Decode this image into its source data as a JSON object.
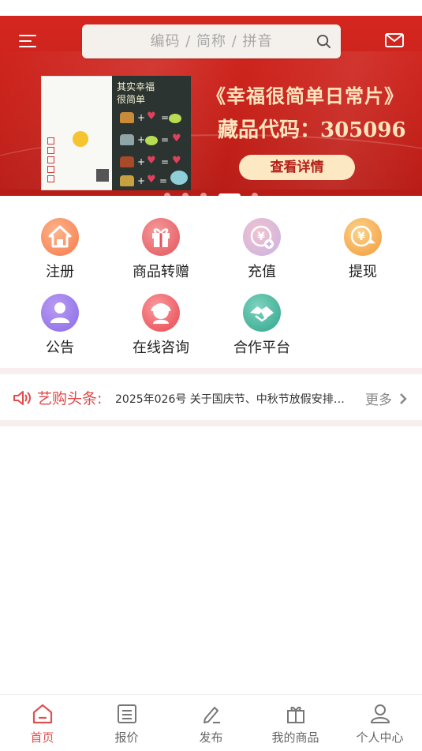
{
  "search": {
    "placeholder": "编码 / 简称 / 拼音"
  },
  "banner": {
    "title": "《幸福很简单日常片》",
    "code_line": "藏品代码：305096",
    "button_label": "查看详情",
    "stamp_title_line1": "其实幸福",
    "stamp_title_line2": "很简单",
    "dot_count": 5,
    "active_dot_index": 3
  },
  "grid": {
    "items": [
      {
        "label": "注册",
        "icon": "home-icon"
      },
      {
        "label": "商品转赠",
        "icon": "gift-icon"
      },
      {
        "label": "充值",
        "icon": "yuan-plus-icon"
      },
      {
        "label": "提现",
        "icon": "yuan-withdraw-icon"
      },
      {
        "label": "公告",
        "icon": "user-announce-icon"
      },
      {
        "label": "在线咨询",
        "icon": "support-agent-icon"
      },
      {
        "label": "合作平台",
        "icon": "handshake-icon"
      }
    ]
  },
  "ticker": {
    "head": "艺购头条:",
    "news": "2025年026号 关于国庆节、中秋节放假安排的...",
    "more": "更多"
  },
  "tabbar": {
    "items": [
      {
        "label": "首页",
        "icon": "home-tab-icon",
        "active": true
      },
      {
        "label": "报价",
        "icon": "quote-list-icon",
        "active": false
      },
      {
        "label": "发布",
        "icon": "edit-pen-icon",
        "active": false
      },
      {
        "label": "我的商品",
        "icon": "gift-box-icon",
        "active": false
      },
      {
        "label": "个人中心",
        "icon": "user-icon",
        "active": false
      }
    ]
  },
  "colors": {
    "brand_red": "#d4261f",
    "accent_red": "#e05050",
    "banner_text": "#fde6bf"
  }
}
